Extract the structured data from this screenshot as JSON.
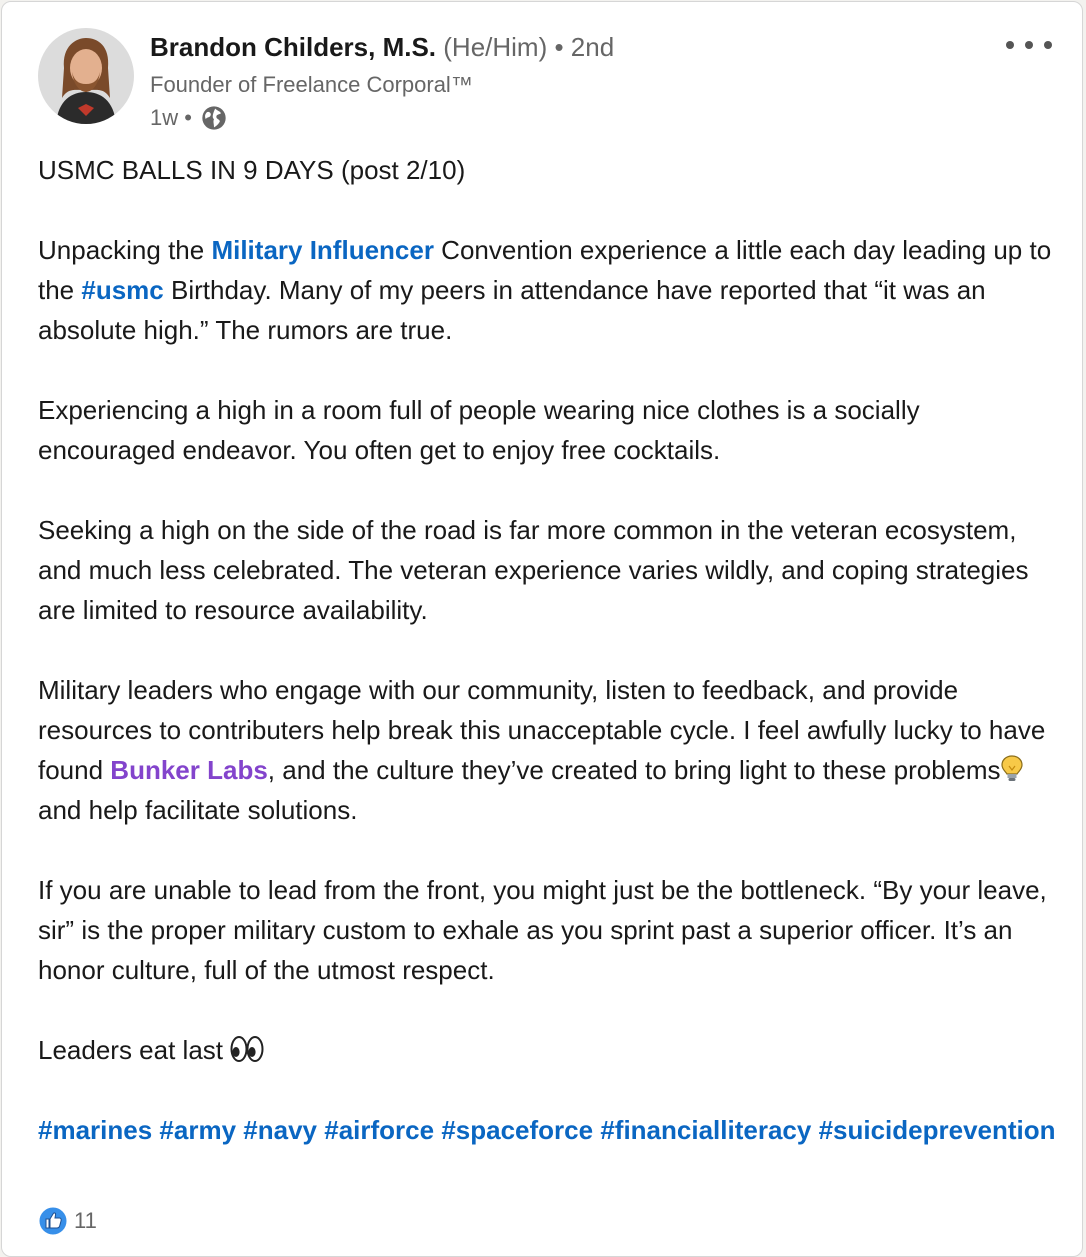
{
  "author": {
    "name": "Brandon Childers, M.S.",
    "pronouns_degree": "(He/Him) • 2nd",
    "headline": "Founder of Freelance Corporal™",
    "time": "1w •",
    "avatar_icon": "profile-photo",
    "visibility_icon": "globe-icon"
  },
  "menu": {
    "icon": "more-options-icon"
  },
  "post": {
    "line1": "USMC BALLS IN 9 DAYS (post 2/10)",
    "p2_a": "Unpacking the ",
    "p2_link1": "Military Influencer",
    "p2_b": " Convention experience a little each day leading up to the ",
    "p2_hashtag": "#usmc",
    "p2_c": " Birthday. Many of my peers in attendance have reported that “it was an absolute high.” The rumors are true.",
    "p3": "Experiencing a high in a room full of people wearing nice clothes is a socially encouraged endeavor. You often get to enjoy free cocktails.",
    "p4": "Seeking a high on the side of the road is far more common in the veteran ecosystem, and much less celebrated. The veteran experience varies wildly, and coping strategies are limited to resource availability.",
    "p5_a": "Military leaders who engage with our community, listen to feedback, and provide resources to contributers help break this unacceptable cycle. I feel awfully lucky to have found ",
    "p5_link": "Bunker Labs",
    "p5_b": ", and the culture they’ve created to bring light to these problems",
    "p5_c": "and help facilitate solutions.",
    "p6": "If you are unable to lead from the front, you might just be the bottleneck. “By your leave, sir” is the proper military custom to exhale as you sprint past a superior officer. It’s an honor culture, full of the utmost respect.",
    "p7": "Leaders eat last ",
    "hashtags": [
      "#marines",
      "#army",
      "#navy",
      "#airforce",
      "#spaceforce",
      "#financialliteracy",
      "#suicideprevention"
    ]
  },
  "reactions": {
    "count": "11",
    "icon": "like-icon"
  },
  "colors": {
    "link_blue": "#0a66c2",
    "company_purple": "#8344cc",
    "text": "#191919",
    "muted": "#666666"
  }
}
